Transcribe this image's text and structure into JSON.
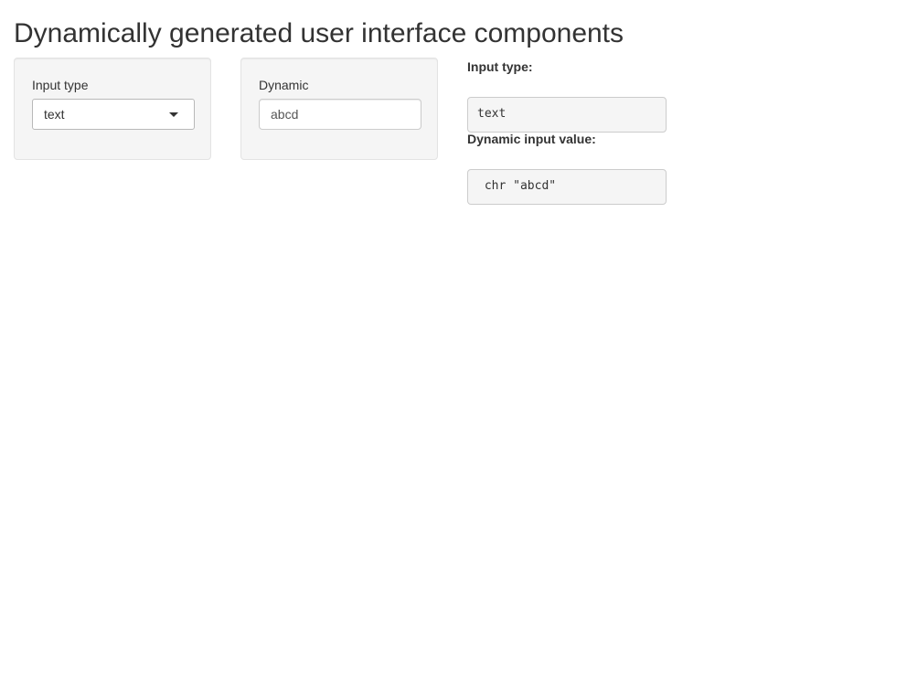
{
  "page": {
    "title": "Dynamically generated user interface components"
  },
  "sidebar": {
    "input_type_label": "Input type",
    "input_type_selected": "text"
  },
  "dynamic": {
    "label": "Dynamic",
    "value": "abcd"
  },
  "output": {
    "input_type_heading": "Input type:",
    "input_type_value": "text",
    "dynamic_heading": "Dynamic input value:",
    "dynamic_value": " chr \"abcd\""
  },
  "icons": {
    "select_caret": "caret-down-icon"
  }
}
